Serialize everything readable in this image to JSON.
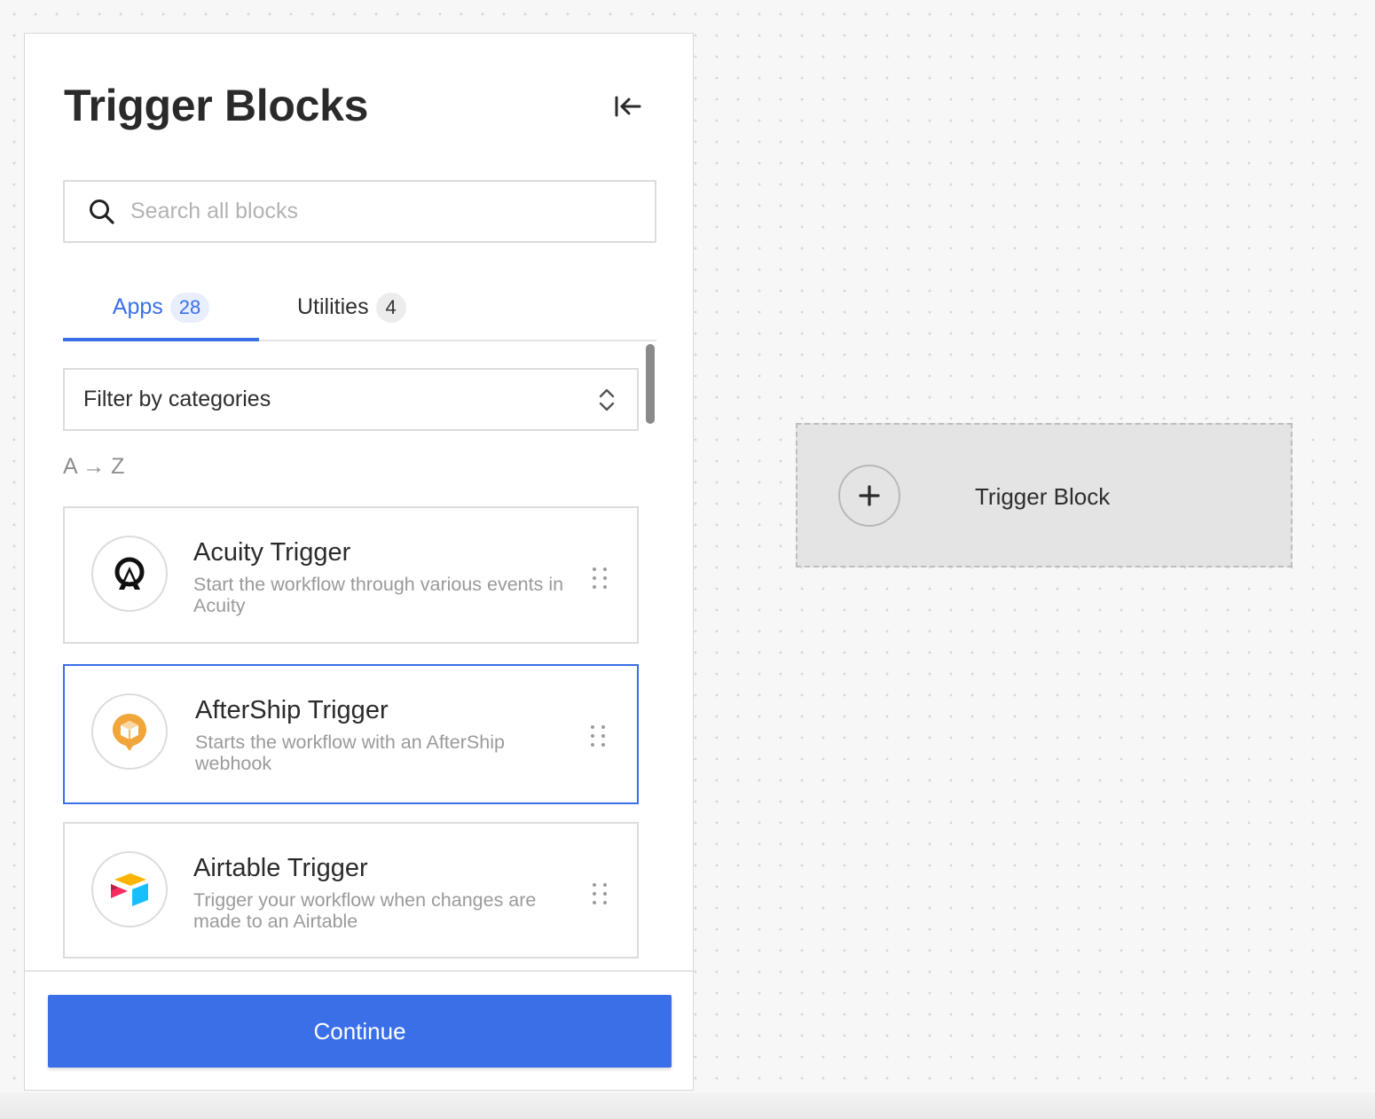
{
  "panel": {
    "title": "Trigger Blocks",
    "collapse_icon": "collapse-left-icon"
  },
  "search": {
    "placeholder": "Search all blocks",
    "value": ""
  },
  "tabs": [
    {
      "label": "Apps",
      "count": "28",
      "active": true
    },
    {
      "label": "Utilities",
      "count": "4",
      "active": false
    }
  ],
  "filter": {
    "label": "Filter by categories"
  },
  "sort_label": "A → Z",
  "blocks": [
    {
      "name": "Acuity Trigger",
      "description": "Start the workflow through various events in Acuity",
      "icon": "acuity-logo-icon"
    },
    {
      "name": "AfterShip Trigger",
      "description": "Starts the workflow with an AfterShip webhook",
      "icon": "aftership-logo-icon",
      "selected": true
    },
    {
      "name": "Airtable Trigger",
      "description": "Trigger your workflow when changes are made to an Airtable",
      "icon": "airtable-logo-icon"
    }
  ],
  "footer": {
    "continue_label": "Continue"
  },
  "canvas": {
    "trigger_label": "Trigger Block"
  },
  "colors": {
    "accent": "#3a6fe8",
    "aftership_orange": "#f0a63a"
  }
}
